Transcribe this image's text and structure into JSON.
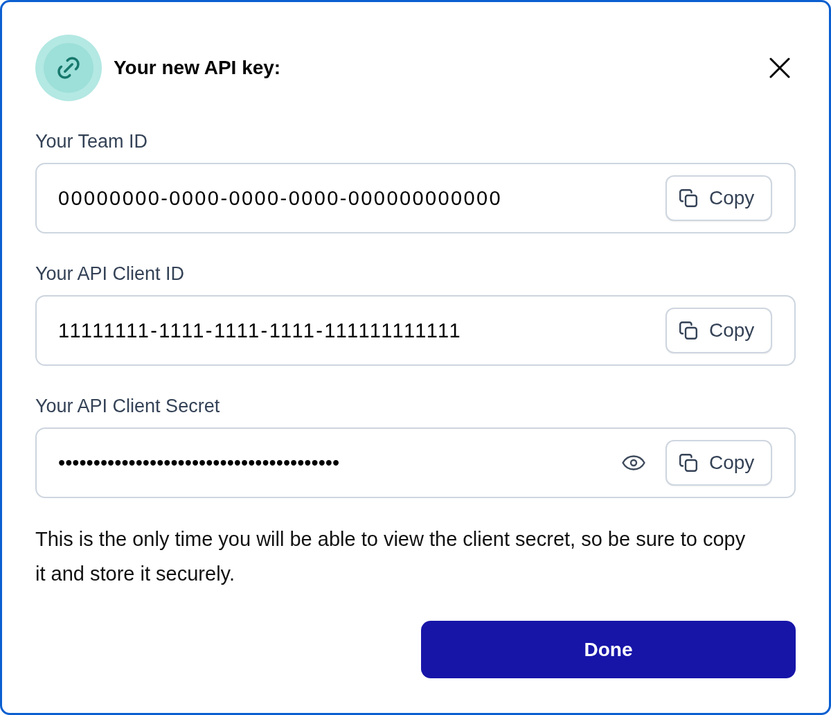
{
  "dialog": {
    "title": "Your new API key:"
  },
  "fields": [
    {
      "kind": "text",
      "label": "Your Team ID",
      "value": "00000000-0000-0000-0000-000000000000",
      "copy_button": "Copy"
    },
    {
      "kind": "text",
      "label": "Your API Client ID",
      "value": "11111111-1111-1111-1111-111111111111",
      "copy_button": "Copy"
    },
    {
      "kind": "secret",
      "label": "Your API Client Secret",
      "value": "••••••••••••••••••••••••••••••••••••••••",
      "copy_button": "Copy"
    }
  ],
  "notice": "This is the only time you will be able to view the client secret, so be sure to copy it and store it securely.",
  "buttons": [
    {
      "label": "Done"
    }
  ]
}
